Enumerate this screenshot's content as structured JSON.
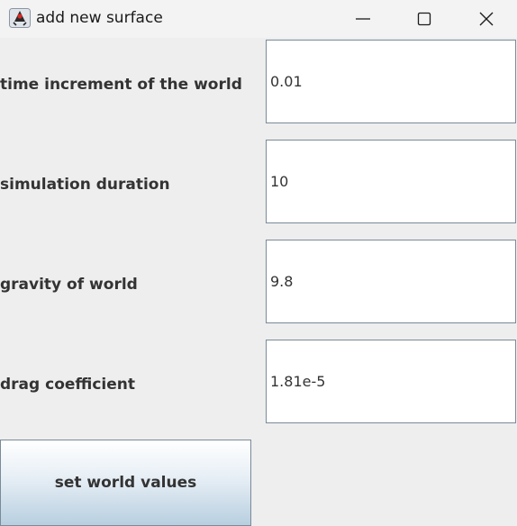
{
  "window": {
    "title": "add new surface",
    "app_icon": "java-duke-icon",
    "controls": [
      "minimize-icon",
      "maximize-icon",
      "close-icon"
    ]
  },
  "fields": [
    {
      "label": "time increment of the world",
      "value": "0.01"
    },
    {
      "label": "simulation duration",
      "value": "10"
    },
    {
      "label": "gravity of world",
      "value": "9.8"
    },
    {
      "label": "drag coefficient",
      "value": "1.81e-5"
    }
  ],
  "submit": {
    "label": "set world values"
  },
  "colors": {
    "background": "#eeeeee",
    "titlebar": "#f3f3f3",
    "input_border": "#7a8a99",
    "button_gradient_bottom": "#b8cfe0",
    "text": "#333333"
  }
}
